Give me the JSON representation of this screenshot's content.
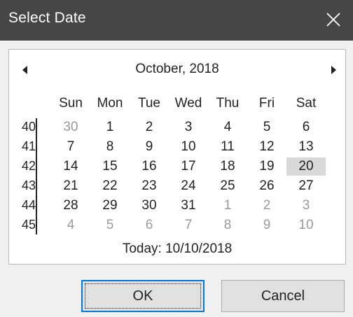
{
  "window": {
    "title": "Select Date",
    "close_icon": "close-icon"
  },
  "calendar": {
    "month_label": "October, 2018",
    "prev_icon": "triangle-left-icon",
    "next_icon": "triangle-right-icon",
    "weekdays": [
      "Sun",
      "Mon",
      "Tue",
      "Wed",
      "Thu",
      "Fri",
      "Sat"
    ],
    "week_numbers": [
      "40",
      "41",
      "42",
      "43",
      "44",
      "45"
    ],
    "weeks": [
      [
        {
          "d": "30",
          "other": true
        },
        {
          "d": "1"
        },
        {
          "d": "2"
        },
        {
          "d": "3"
        },
        {
          "d": "4"
        },
        {
          "d": "5"
        },
        {
          "d": "6"
        }
      ],
      [
        {
          "d": "7"
        },
        {
          "d": "8"
        },
        {
          "d": "9"
        },
        {
          "d": "10"
        },
        {
          "d": "11"
        },
        {
          "d": "12"
        },
        {
          "d": "13"
        }
      ],
      [
        {
          "d": "14"
        },
        {
          "d": "15"
        },
        {
          "d": "16"
        },
        {
          "d": "17"
        },
        {
          "d": "18"
        },
        {
          "d": "19"
        },
        {
          "d": "20",
          "selected": true
        }
      ],
      [
        {
          "d": "21"
        },
        {
          "d": "22"
        },
        {
          "d": "23"
        },
        {
          "d": "24"
        },
        {
          "d": "25"
        },
        {
          "d": "26"
        },
        {
          "d": "27"
        }
      ],
      [
        {
          "d": "28"
        },
        {
          "d": "29"
        },
        {
          "d": "30"
        },
        {
          "d": "31"
        },
        {
          "d": "1",
          "other": true
        },
        {
          "d": "2",
          "other": true
        },
        {
          "d": "3",
          "other": true
        }
      ],
      [
        {
          "d": "4",
          "other": true
        },
        {
          "d": "5",
          "other": true
        },
        {
          "d": "6",
          "other": true
        },
        {
          "d": "7",
          "other": true
        },
        {
          "d": "8",
          "other": true
        },
        {
          "d": "9",
          "other": true
        },
        {
          "d": "10",
          "other": true
        }
      ]
    ],
    "today_label": "Today: 10/10/2018"
  },
  "buttons": {
    "ok_label": "OK",
    "cancel_label": "Cancel"
  },
  "colors": {
    "titlebar": "#464646",
    "selected_day": "#d9d9d9",
    "other_month_day": "#9a9a9a",
    "default_button_border": "#0078d7"
  }
}
